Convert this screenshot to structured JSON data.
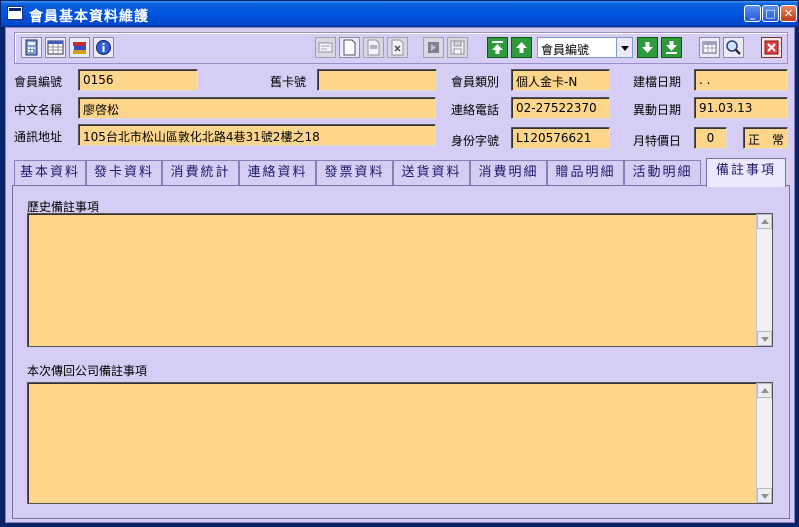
{
  "window": {
    "title": "會員基本資料維護",
    "minimize_glyph": "_",
    "maximize_glyph": "□",
    "close_glyph": "✕"
  },
  "toolbar": {
    "buttons_left": [
      "calculator-icon",
      "calendar-icon",
      "books-icon",
      "info-icon"
    ],
    "buttons_mid": [
      "card-icon",
      "new-document-icon",
      "open-document-icon",
      "delete-document-icon",
      "undo-icon",
      "save-icon",
      "first-record-icon",
      "previous-record-icon"
    ],
    "sort_field": {
      "value": "會員編號"
    },
    "buttons_right": [
      "next-record-icon",
      "last-record-icon",
      "grid-icon",
      "search-icon",
      "close-icon"
    ]
  },
  "form": {
    "member_no_label": "會員編號",
    "member_no": "0156",
    "old_card_label": "舊卡號",
    "old_card": "",
    "member_type_label": "會員類別",
    "member_type": "個人金卡-N",
    "created_date_label": "建檔日期",
    "created_date": " . .",
    "chinese_name_label": "中文名稱",
    "chinese_name": "廖啓松",
    "phone_label": "連絡電話",
    "phone": "02-27522370",
    "changed_date_label": "異動日期",
    "changed_date": "91.03.13",
    "address_label": "通訊地址",
    "address": "105台北市松山區敦化北路4巷31號2樓之18",
    "id_no_label": "身份字號",
    "id_no": "L120576621",
    "special_price_day_label": "月特價日",
    "special_price_day": "0",
    "status": "正　常"
  },
  "tabs": [
    {
      "label": "基本資料"
    },
    {
      "label": "發卡資料"
    },
    {
      "label": "消費統計"
    },
    {
      "label": "連絡資料"
    },
    {
      "label": "發票資料"
    },
    {
      "label": "送貨資料"
    },
    {
      "label": "消費明細"
    },
    {
      "label": "贈品明細"
    },
    {
      "label": "活動明細"
    },
    {
      "label": "備註事項"
    }
  ],
  "active_tab": "備註事項",
  "notes": {
    "history_label": "歷史備註事項",
    "history_value": "",
    "return_label": "本次傳回公司備註事項",
    "return_value": ""
  },
  "colors": {
    "form_background": "#d6cdf4",
    "field_background": "#fdd68c",
    "titlebar": "#0054e3"
  }
}
